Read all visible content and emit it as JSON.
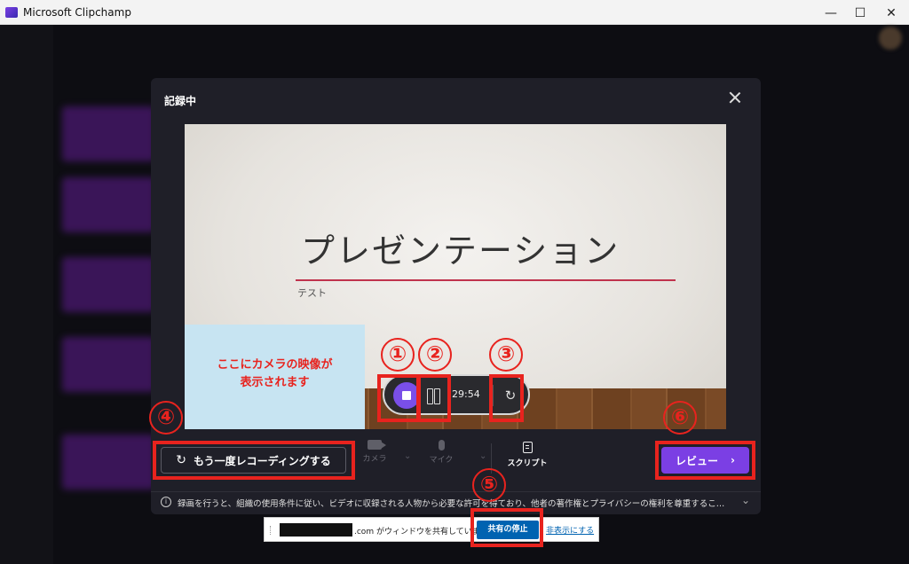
{
  "window": {
    "title": "Microsoft Clipchamp",
    "minimize_glyph": "—",
    "maximize_glyph": "☐",
    "close_glyph": "✕"
  },
  "dialog": {
    "title": "記録中",
    "close_icon": "close-icon"
  },
  "slide": {
    "title": "プレゼンテーション",
    "subtitle": "テスト"
  },
  "camera_placeholder": {
    "line1": "ここにカメラの映像が",
    "line2": "表示されます"
  },
  "recorder": {
    "timer": "29:54",
    "reset_glyph": "↻"
  },
  "controls": {
    "rerecord_label": "もう一度レコーディングする",
    "rerecord_glyph": "↻",
    "camera_label": "カメラ",
    "mic_label": "マイク",
    "dropdown_glyph": "⌄",
    "script_label": "スクリプト",
    "review_label": "レビュー",
    "review_chevron": "›"
  },
  "notice": {
    "info_glyph": "i",
    "text": "録画を行うと、組織の使用条件に従い、ビデオに収録される人物から必要な許可を得ており、他者の著作権とプライバシーの権利を尊重することに同...",
    "expand_glyph": "⌄"
  },
  "share_bar": {
    "text": ".com がウィンドウを共有しています。",
    "stop_label": "共有の停止",
    "hide_label": "非表示にする"
  },
  "annotations": [
    "①",
    "②",
    "③",
    "④",
    "⑤",
    "⑥"
  ],
  "colors": {
    "accent_purple": "#7b3fe4",
    "annotation_red": "#e8231e",
    "dialog_bg": "#1f1f28",
    "share_blue": "#0063b1"
  }
}
